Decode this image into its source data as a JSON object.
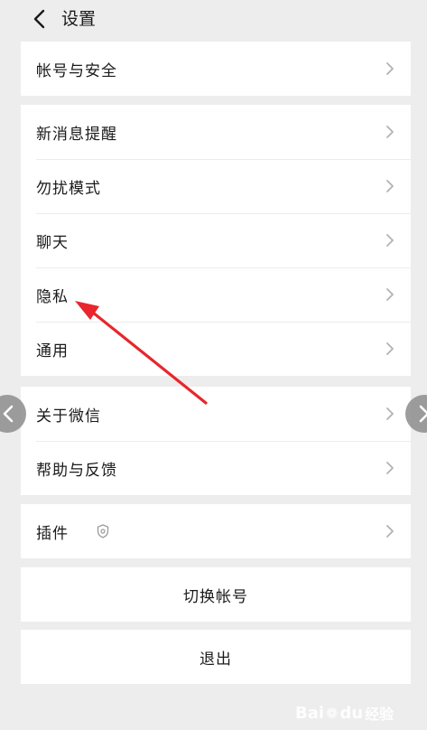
{
  "header": {
    "title": "设置"
  },
  "groups": [
    {
      "items": [
        {
          "label": "帐号与安全"
        }
      ]
    },
    {
      "items": [
        {
          "label": "新消息提醒"
        },
        {
          "label": "勿扰模式"
        },
        {
          "label": "聊天"
        },
        {
          "label": "隐私"
        },
        {
          "label": "通用"
        }
      ]
    },
    {
      "items": [
        {
          "label": "关于微信"
        },
        {
          "label": "帮助与反馈"
        }
      ]
    },
    {
      "items": [
        {
          "label": "插件"
        }
      ]
    }
  ],
  "actions": {
    "switch_account": "切换帐号",
    "logout": "退出"
  },
  "watermark": {
    "brand": "Bai",
    "brand_end": "du",
    "sub": "经验"
  },
  "colors": {
    "background": "#ededed",
    "card": "#ffffff",
    "annotation_arrow": "#e8262b",
    "chevron": "#b2b2b2"
  },
  "icons": {
    "back": "chevron-left-icon",
    "row_arrow": "chevron-right-icon",
    "plugin_badge": "shield-icon"
  }
}
